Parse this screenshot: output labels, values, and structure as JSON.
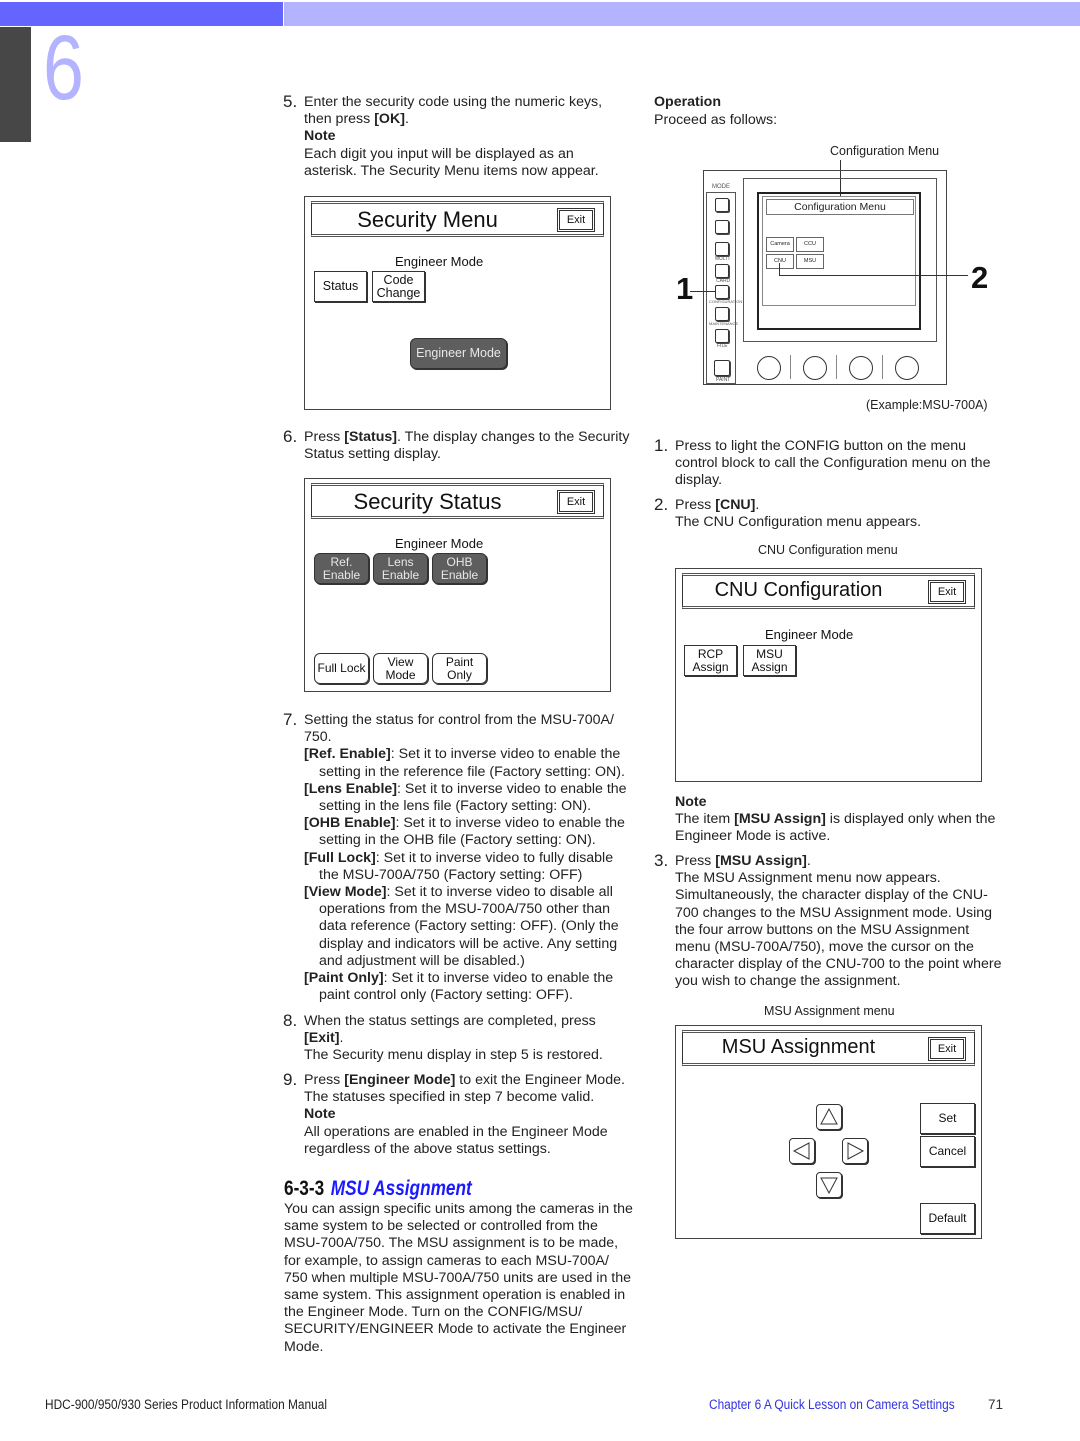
{
  "header": {
    "chapter_number": "6",
    "colors": {
      "bar_dark": "#6464ff",
      "bar_light": "#b3b3ff",
      "side_tab": "#474747",
      "heading_blue": "#1a1aff"
    }
  },
  "left": {
    "step5": {
      "num": "5.",
      "text_a": "Enter the security code using the numeric keys, then press ",
      "text_b": "[OK]",
      "text_c": ".",
      "note_label": "Note",
      "note_text": "Each digit you input will be displayed as an asterisk. The Security Menu items now appear."
    },
    "security_menu": {
      "title": "Security Menu",
      "exit": "Exit",
      "mode_label": "Engineer Mode",
      "buttons": [
        "Status",
        "Code",
        "Change"
      ],
      "engineer_button": "Engineer Mode"
    },
    "step6": {
      "num": "6.",
      "text_a": "Press ",
      "text_b": "[Status]",
      "text_c": ". The display changes to the Security Status setting display."
    },
    "security_status": {
      "title": "Security Status",
      "exit": "Exit",
      "mode_label": "Engineer Mode",
      "inverse_buttons": [
        {
          "l1": "Ref.",
          "l2": "Enable"
        },
        {
          "l1": "Lens",
          "l2": "Enable"
        },
        {
          "l1": "OHB",
          "l2": "Enable"
        }
      ],
      "normal_buttons": [
        {
          "l1": "Full Lock",
          "l2": ""
        },
        {
          "l1": "View",
          "l2": "Mode"
        },
        {
          "l1": "Paint",
          "l2": "Only"
        }
      ]
    },
    "step7": {
      "num": "7.",
      "intro": "Setting the status for control from the MSU-700A/ 750.",
      "items": [
        {
          "term": "[Ref. Enable]",
          "desc": ": Set it to inverse video to enable the setting in the reference file (Factory setting: ON)."
        },
        {
          "term": "[Lens Enable]",
          "desc": ": Set it to inverse video to enable the setting in the lens file (Factory setting: ON)."
        },
        {
          "term": "[OHB Enable]",
          "desc": ": Set it to inverse video to enable the setting in the OHB file (Factory setting: ON)."
        },
        {
          "term": "[Full Lock]",
          "desc": ": Set it to inverse video to fully disable the MSU-700A/750 (Factory setting: OFF)"
        },
        {
          "term": "[View Mode]",
          "desc": ": Set it to inverse video to disable all operations from the MSU-700A/750 other than data reference (Factory setting: OFF). (Only the display and indicators will be active. Any setting and adjustment will be disabled.)"
        },
        {
          "term": "[Paint Only]",
          "desc": ": Set it to inverse video to enable the paint control only (Factory setting: OFF)."
        }
      ]
    },
    "step8": {
      "num": "8.",
      "text_a": "When the status settings are completed, press ",
      "text_b": "[Exit]",
      "text_c": ".",
      "text_d": "The Security menu display in step 5 is restored."
    },
    "step9": {
      "num": "9.",
      "text_a": "Press ",
      "text_b": "[Engineer Mode]",
      "text_c": " to exit the Engineer Mode. The statuses specified in step 7 become valid.",
      "note_label": "Note",
      "note_text": "All operations are enabled in the Engineer Mode regardless of the above status settings."
    },
    "section": {
      "number": "6-3-3",
      "title": "MSU Assignment",
      "body": "You can assign specific units among the cameras in the same system to be selected or controlled from the MSU-700A/750. The MSU assignment is to be made, for example, to assign cameras to each MSU-700A/ 750 when multiple MSU-700A/750 units are used in the same system. This assignment operation is enabled in the Engineer Mode. Turn on the CONFIG/MSU/ SECURITY/ENGINEER Mode to activate the Engineer Mode."
    }
  },
  "right": {
    "operation_label": "Operation",
    "operation_text": "Proceed as follows:",
    "diagram": {
      "callout_top": "Configuration Menu",
      "mode_label": "MODE",
      "mode_buttons": [
        "",
        "",
        "MULTI",
        "CARD",
        "CONFIGURATION",
        "MAINTENANCE",
        "FILE",
        "PAINT"
      ],
      "screen_title": "Configuration Menu",
      "screen_buttons": [
        "Camera",
        "CCU",
        "CNU",
        "MSU"
      ],
      "callout_1": "1",
      "callout_2": "2",
      "example_caption": "(Example:MSU-700A)"
    },
    "step1": {
      "num": "1.",
      "text": "Press to light the CONFIG button on the menu control block to call the Configuration menu on the display."
    },
    "step2": {
      "num": "2.",
      "text_a": "Press ",
      "text_b": "[CNU]",
      "text_c": ".",
      "text_d": "The CNU Configuration menu appears."
    },
    "cnu_caption": "CNU Configuration menu",
    "cnu_config": {
      "title": "CNU Configuration",
      "exit": "Exit",
      "mode_label": "Engineer Mode",
      "buttons": [
        {
          "l1": "RCP",
          "l2": "Assign"
        },
        {
          "l1": "MSU",
          "l2": "Assign"
        }
      ]
    },
    "note": {
      "label": "Note",
      "text_a": "The item ",
      "text_b": "[MSU Assign]",
      "text_c": " is displayed only when the Engineer Mode is active."
    },
    "step3": {
      "num": "3.",
      "text_a": "Press ",
      "text_b": "[MSU Assign]",
      "text_c": ".",
      "text_d": "The MSU Assignment menu now appears. Simultaneously, the character display of the CNU-700 changes to the MSU Assignment mode. Using the four arrow buttons on the MSU Assignment menu (MSU-700A/750), move the cursor on the character display of the CNU-700 to the point where you wish to change the assignment."
    },
    "msu_caption": "MSU Assignment menu",
    "msu_assignment": {
      "title": "MSU Assignment",
      "exit": "Exit",
      "arrows": [
        "arrow-up",
        "arrow-left",
        "arrow-right",
        "arrow-down"
      ],
      "set": "Set",
      "cancel": "Cancel",
      "default": "Default"
    }
  },
  "footer": {
    "manual_title": "HDC-900/950/930 Series Product Information Manual",
    "chapter_link": "Chapter 6  A Quick Lesson on Camera Settings",
    "page_number": "71"
  }
}
